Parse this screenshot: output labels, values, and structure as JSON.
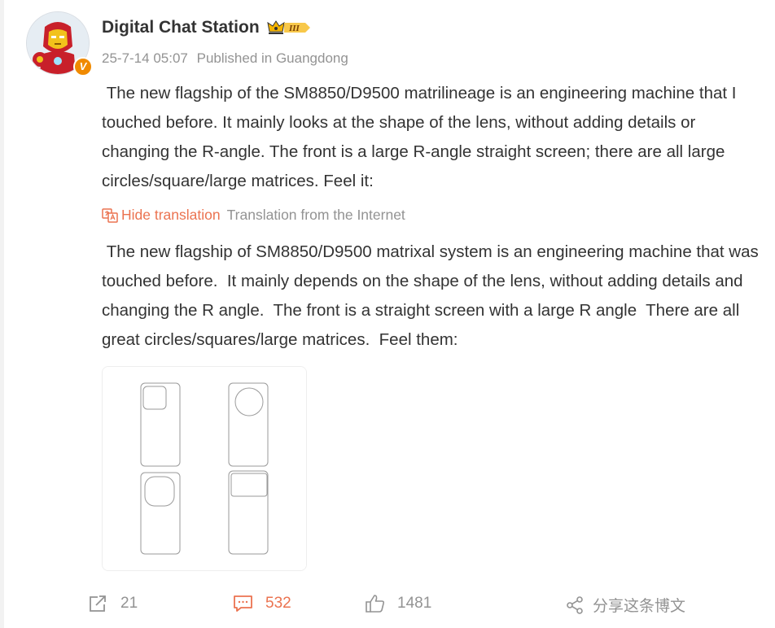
{
  "post": {
    "author": "Digital Chat Station",
    "rank_badge": "III",
    "verified_badge": "V",
    "timestamp": "25-7-14 05:07",
    "location": "Published in Guangdong",
    "text_original": " The new flagship of the SM8850/D9500 matrilineage is an engineering machine that I touched before. It mainly looks at the shape of the lens, without adding details or changing the R-angle. The front is a large R-angle straight screen; there are all large circles/square/large matrices. Feel it:",
    "translation_toggle": "Hide translation",
    "translation_source": "Translation from the Internet",
    "text_translated": " The new flagship of SM8850/D9500 matrixal system is an engineering machine that was touched before.  It mainly depends on the shape of the lens, without adding details and changing the R angle.  The front is a straight screen with a large R angle  There are all great circles/squares/large matrices.  Feel them:"
  },
  "footer": {
    "repost_count": "21",
    "comment_count": "532",
    "like_count": "1481",
    "share_label": "分享这条博文"
  },
  "icons": {
    "avatar": "ironman-avatar",
    "rank": "crown-icon",
    "translate": "translate-icon",
    "repost": "repost-icon",
    "comment": "comment-icon",
    "like": "thumbs-up-icon",
    "share": "share-icon"
  },
  "colors": {
    "accent": "#eb7350",
    "meta_gray": "#939393",
    "text": "#333333",
    "badge_gold": "#f5b400"
  }
}
